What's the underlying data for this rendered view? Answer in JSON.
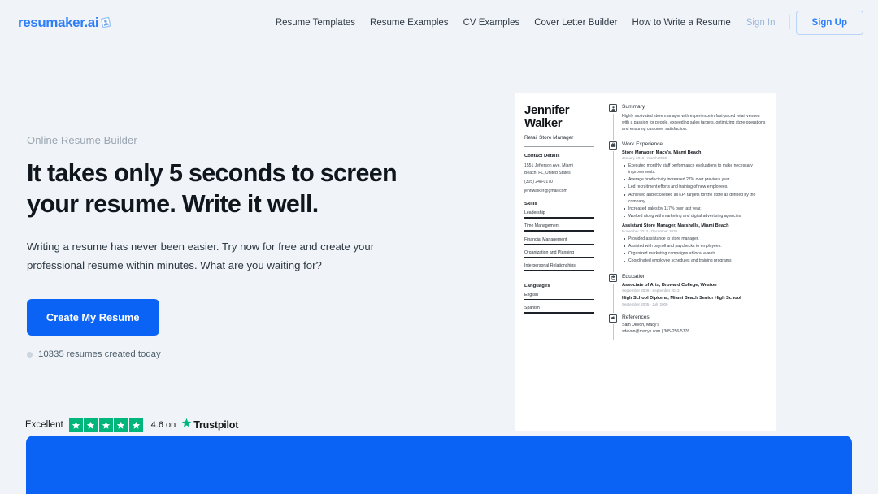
{
  "brand": {
    "logo_text": "resumaker.ai",
    "logo_icon": "resume-document-icon",
    "accent_color": "#0b63f6",
    "link_color": "#2d7ff9"
  },
  "nav": {
    "links": [
      {
        "label": "Resume Templates"
      },
      {
        "label": "Resume Examples"
      },
      {
        "label": "CV Examples"
      },
      {
        "label": "Cover Letter Builder"
      },
      {
        "label": "How to Write a Resume"
      }
    ],
    "sign_in": "Sign In",
    "sign_up": "Sign Up"
  },
  "hero": {
    "eyebrow": "Online Resume Builder",
    "headline": "It takes only 5 seconds to screen your resume. Write it well.",
    "subcopy": "Writing a resume has never been easier. Try now for free and create your professional resume within minutes. What are you waiting for?",
    "cta_label": "Create My Resume",
    "counter_text": "10335 resumes created today",
    "counter_icon": "dot-icon"
  },
  "trustpilot": {
    "rating_word": "Excellent",
    "stars": 5,
    "star_color": "#00b67a",
    "score_text": "4.6 on",
    "brand_name": "Trustpilot",
    "brand_icon": "trustpilot-star-icon"
  },
  "resume": {
    "name": "Jennifer Walker",
    "role": "Retail Store Manager",
    "contact": {
      "title": "Contact Details",
      "address_line_1": "1551 Jefferson Ave, Miami",
      "address_line_2": "Beach, FL, United States",
      "phone": "(305) 248-0170",
      "email": "jennwalker@gmail.com"
    },
    "skills": {
      "title": "Skills",
      "items": [
        "Leadership",
        "Time Management",
        "Financial Management",
        "Organization and Planning",
        "Interpersonal Relationships"
      ]
    },
    "languages": {
      "title": "Languages",
      "items": [
        "English",
        "Spanish"
      ]
    },
    "summary": {
      "title": "Summary",
      "icon": "person-badge-icon",
      "text": "Highly motivated store manager with experience in fast-paced retail venues with a passion for people, exceeding sales targets, optimizing store operations and ensuring customer satisfaction."
    },
    "work": {
      "title": "Work Experience",
      "icon": "briefcase-icon",
      "jobs": [
        {
          "title": "Store Manager, Macy's, Miami Beach",
          "date": "January 2016 - March 2020",
          "bullets": [
            "Executed monthly staff performance evaluations to make necessary improvements.",
            "Average productivity increased 27% over previous year.",
            "Led recruitment efforts and training of new employees.",
            "Achieved and exceeded all KPI targets for the store as defined by the company.",
            "Increased sales by 117% over last year.",
            "Worked along with marketing and digital advertising agencies."
          ]
        },
        {
          "title": "Assistant Store Manager, Marshalls, Miami Beach",
          "date": "November 2013 - December 2020",
          "bullets": [
            "Provided assistance to store manager.",
            "Assisted with payroll and paychecks to employees.",
            "Organized marketing campaigns at local events.",
            "Coordinated employee schedules and training programs."
          ]
        }
      ]
    },
    "education": {
      "title": "Education",
      "icon": "graduation-cap-icon",
      "items": [
        {
          "title": "Associate of Arts, Broward College, Weston",
          "date": "September 2009 - September 2013"
        },
        {
          "title": "High School Diploma, Miami Beach Senior High School",
          "date": "September 2005 - July 2009"
        }
      ]
    },
    "references": {
      "title": "References",
      "icon": "megaphone-icon",
      "name": "Sam Devon, Macy's",
      "contact": "sdevon@macys.com | 305-256-5776"
    }
  }
}
